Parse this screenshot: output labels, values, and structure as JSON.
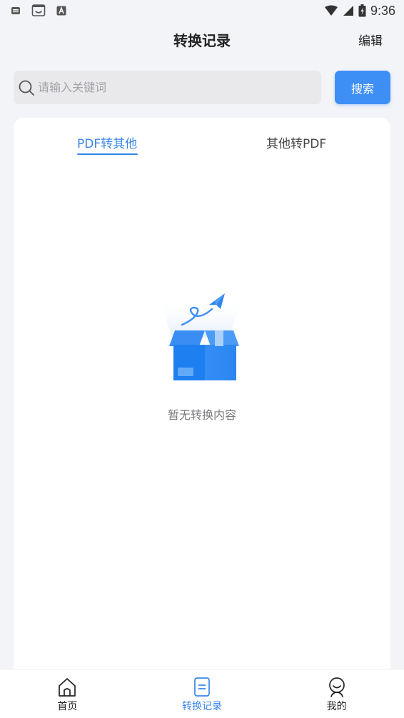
{
  "status_bar": {
    "time": "9:36"
  },
  "header": {
    "title": "转换记录",
    "edit_label": "编辑"
  },
  "search": {
    "placeholder": "请输入关键词",
    "value": "",
    "button_label": "搜索"
  },
  "tabs": [
    {
      "label": "PDF转其他",
      "active": true
    },
    {
      "label": "其他转PDF",
      "active": false
    }
  ],
  "empty_state": {
    "message": "暂无转换内容"
  },
  "bottom_nav": [
    {
      "label": "首页",
      "icon": "home-icon",
      "active": false
    },
    {
      "label": "转换记录",
      "icon": "document-icon",
      "active": true
    },
    {
      "label": "我的",
      "icon": "profile-icon",
      "active": false
    }
  ],
  "colors": {
    "accent": "#3e8ff5",
    "background": "#f3f4f8",
    "card": "#ffffff"
  }
}
